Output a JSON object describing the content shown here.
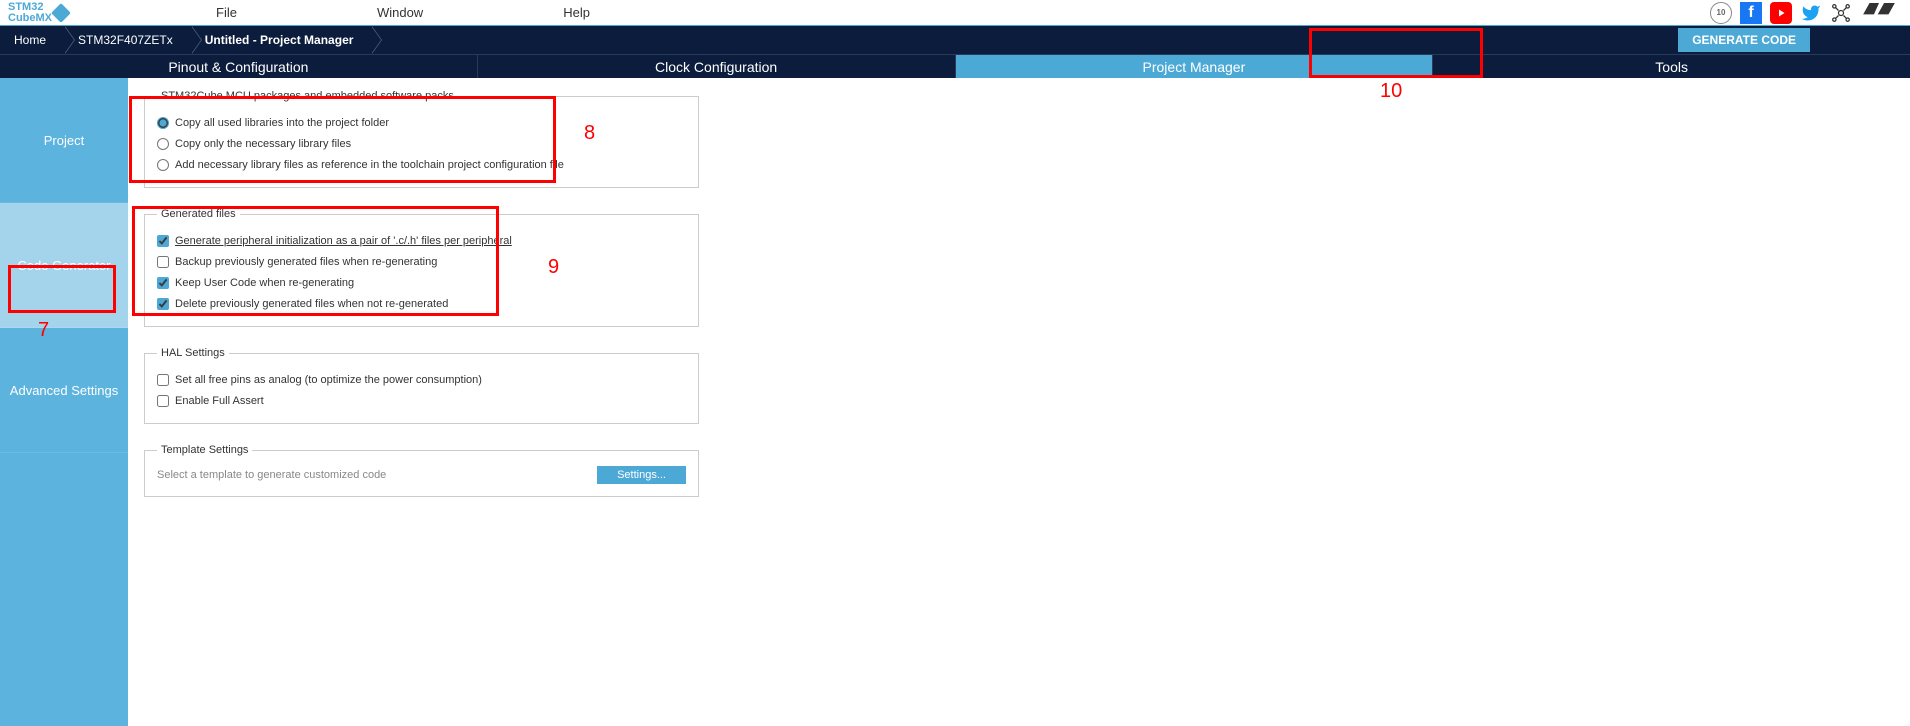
{
  "logo": {
    "line1": "STM32",
    "line2": "CubeMX"
  },
  "menu": {
    "file": "File",
    "window": "Window",
    "help": "Help"
  },
  "breadcrumb": {
    "home": "Home",
    "chip": "STM32F407ZETx",
    "title": "Untitled - Project Manager"
  },
  "generate_button": "GENERATE CODE",
  "main_tabs": {
    "pinout": "Pinout & Configuration",
    "clock": "Clock Configuration",
    "pm": "Project Manager",
    "tools": "Tools"
  },
  "side_nav": {
    "project": "Project",
    "codegen": "Code Generator",
    "advanced": "Advanced Settings"
  },
  "section_mcu": {
    "legend": "STM32Cube MCU packages and embedded software packs",
    "opt1": "Copy all used libraries into the project folder",
    "opt2": "Copy only the necessary library files",
    "opt3": "Add necessary library files as reference in the toolchain project configuration file"
  },
  "section_gen": {
    "legend": "Generated files",
    "opt1": "Generate peripheral initialization as a pair of '.c/.h' files per peripheral",
    "opt2": "Backup previously generated files when re-generating",
    "opt3": "Keep User Code when re-generating",
    "opt4": "Delete previously generated files when not re-generated"
  },
  "section_hal": {
    "legend": "HAL Settings",
    "opt1": "Set all free pins as analog (to optimize the power consumption)",
    "opt2": "Enable Full Assert"
  },
  "section_template": {
    "legend": "Template Settings",
    "text": "Select a template to generate customized code",
    "button": "Settings..."
  },
  "annotations": {
    "a7": "7",
    "a8": "8",
    "a9": "9",
    "a10": "10"
  }
}
